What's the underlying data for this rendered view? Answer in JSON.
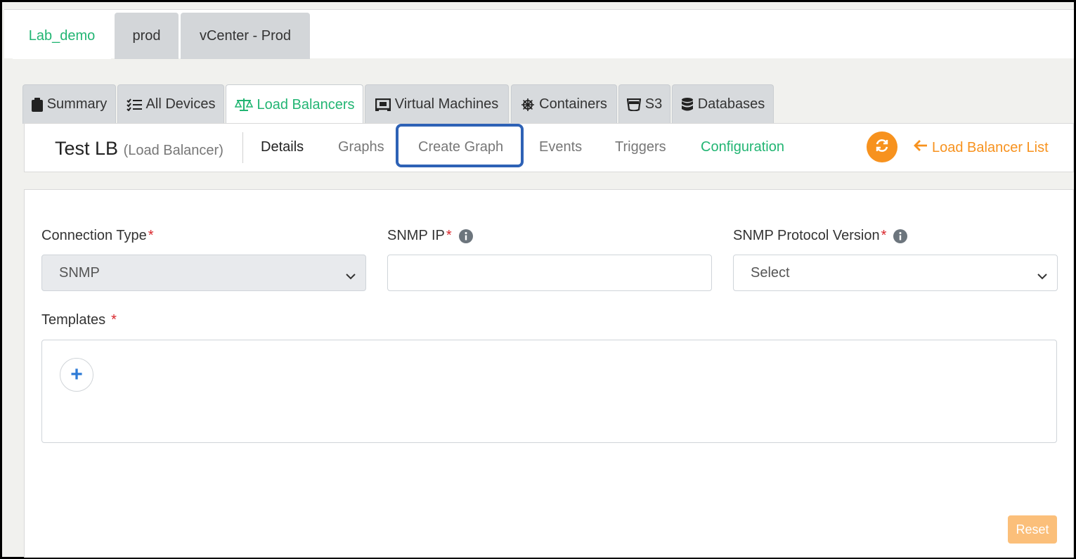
{
  "environments": [
    {
      "label": "Lab_demo",
      "active": true
    },
    {
      "label": "prod",
      "active": false
    },
    {
      "label": "vCenter - Prod",
      "active": false
    }
  ],
  "categories": [
    {
      "label": "Summary",
      "icon": "clipboard-icon"
    },
    {
      "label": "All Devices",
      "icon": "list-check-icon"
    },
    {
      "label": "Load Balancers",
      "icon": "scale-icon",
      "active": true
    },
    {
      "label": "Virtual Machines",
      "icon": "vm-icon"
    },
    {
      "label": "Containers",
      "icon": "helm-icon"
    },
    {
      "label": "S3",
      "icon": "bucket-icon"
    },
    {
      "label": "Databases",
      "icon": "database-icon"
    }
  ],
  "resource": {
    "name": "Test LB",
    "type": "(Load Balancer)"
  },
  "subnav": {
    "details": "Details",
    "graphs": "Graphs",
    "create_graph": "Create Graph",
    "events": "Events",
    "triggers": "Triggers",
    "configuration": "Configuration",
    "back_link": "Load Balancer List"
  },
  "form": {
    "connection_type_label": "Connection Type",
    "connection_type_value": "SNMP",
    "snmp_ip_label": "SNMP IP",
    "snmp_ip_value": "",
    "snmp_version_label": "SNMP Protocol Version",
    "snmp_version_value": "Select",
    "templates_label": "Templates",
    "required_mark": "*",
    "add_symbol": "+",
    "reset_label": "Reset"
  },
  "colors": {
    "accent_green": "#22b573",
    "accent_orange": "#f7921e",
    "highlight_blue": "#2e62b6",
    "required_red": "#d9262c"
  }
}
